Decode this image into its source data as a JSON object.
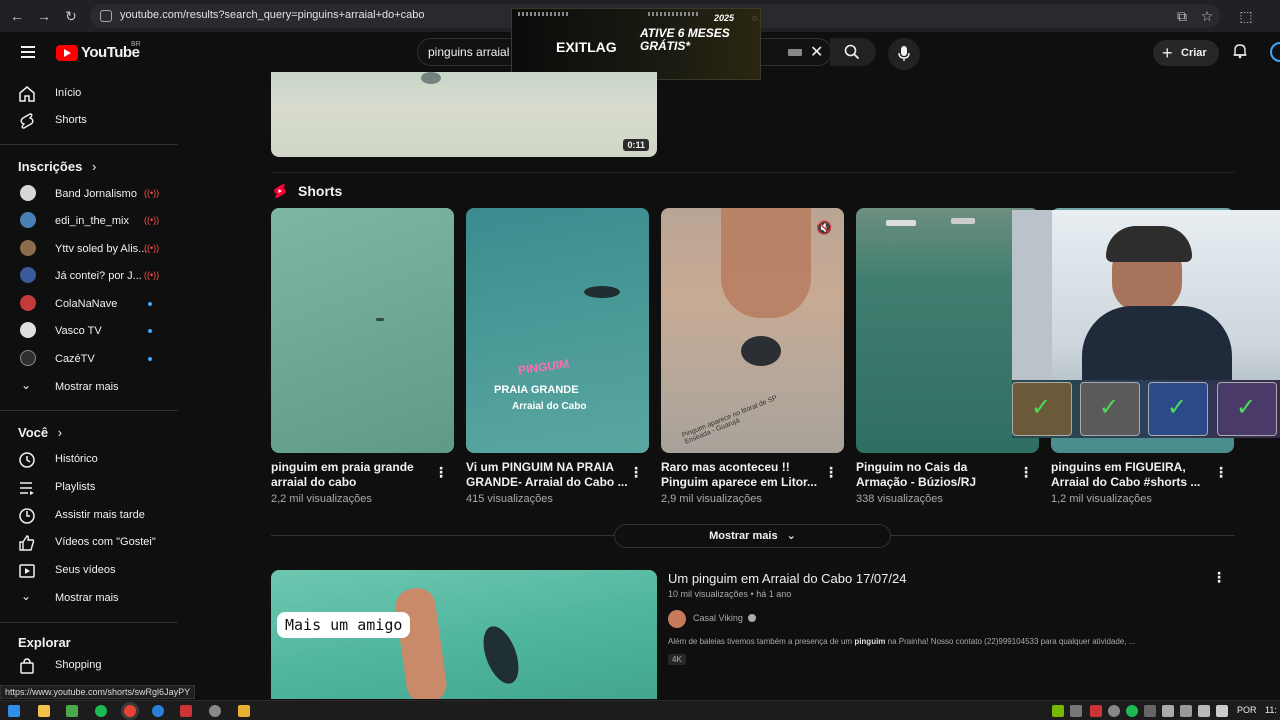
{
  "browser": {
    "url": "youtube.com/results?search_query=pinguins+arraial+do+cabo"
  },
  "header": {
    "logo_text": "YouTube",
    "logo_country": "BR",
    "search_value": "pinguins arraial",
    "create_label": "Criar"
  },
  "ad": {
    "brand": "EXITLAG",
    "headline": "ATIVE 6 MESES GRÁTIS*",
    "year": "2025"
  },
  "sidebar": {
    "top": [
      {
        "label": "Início",
        "icon": "home-icon"
      },
      {
        "label": "Shorts",
        "icon": "shorts-icon"
      }
    ],
    "subscriptions_heading": "Inscrições",
    "subscriptions": [
      {
        "label": "Band Jornalismo",
        "color": "#d7d7d7",
        "live": true
      },
      {
        "label": "edi_in_the_mix",
        "color": "#4a7fb5",
        "live": true
      },
      {
        "label": "Yttv soled by Alis...",
        "color": "#8a6d4c",
        "live": true
      },
      {
        "label": "Já contei? por J...",
        "color": "#3b5a9a",
        "live": true
      },
      {
        "label": "ColaNaNave",
        "color": "#c33b3b",
        "live": false
      },
      {
        "label": "Vasco TV",
        "color": "#e0e0e0",
        "live": false
      },
      {
        "label": "CazéTV",
        "color": "#2f2f2f",
        "live": false
      }
    ],
    "show_more": "Mostrar mais",
    "you_heading": "Você",
    "you_items": [
      {
        "label": "Histórico",
        "icon": "history-icon"
      },
      {
        "label": "Playlists",
        "icon": "playlists-icon"
      },
      {
        "label": "Assistir mais tarde",
        "icon": "watch-later-icon"
      },
      {
        "label": "Vídeos com \"Gostei\"",
        "icon": "like-icon"
      },
      {
        "label": "Seus vídeos",
        "icon": "your-videos-icon"
      },
      {
        "label": "Mostrar mais",
        "icon": "chevron-down-icon"
      }
    ],
    "explore_heading": "Explorar",
    "explore_items": [
      {
        "label": "Shopping",
        "icon": "shopping-icon"
      }
    ]
  },
  "top_video": {
    "duration": "0:11"
  },
  "shorts": {
    "heading": "Shorts",
    "items": [
      {
        "title": "pinguim em praia grande arraial do cabo",
        "views": "2,2 mil visualizações"
      },
      {
        "title": "Vi um PINGUIM NA PRAIA GRANDE- Arraial do Cabo ...",
        "views": "415 visualizações",
        "overlay1": "PINGUIM",
        "overlay2": "PRAIA GRANDE",
        "overlay3": "Arraial do Cabo"
      },
      {
        "title": "Raro mas aconteceu !! Pinguim aparece em Litor...",
        "views": "2,9 mil visualizações",
        "overlay": "Pinguim aparece no litoral de SP Enseada - Guarujá"
      },
      {
        "title": "Pinguim no Cais da Armação - Búzios/RJ",
        "views": "338 visualizações"
      },
      {
        "title": "pinguins em FIGUEIRA, Arraial do Cabo #shorts ...",
        "views": "1,2 mil visualizações"
      }
    ],
    "show_more": "Mostrar mais"
  },
  "video": {
    "title": "Um pinguim em Arraial do Cabo 17/07/24",
    "views": "10 mil visualizações",
    "age": "há 1 ano",
    "channel": "Casal Viking",
    "description_before": "Além de baleias tivemos também a presença de um ",
    "description_bold": "pinguim",
    "description_after": " na Prainha! Nosso contato (22)999104533 para qualquer atividade, ...",
    "badge": "4K",
    "thumb_caption": "Mais um amigo"
  },
  "status_url": "https://www.youtube.com/shorts/swRgl6JayPY",
  "taskbar": {
    "lang": "POR",
    "time": "11:"
  }
}
